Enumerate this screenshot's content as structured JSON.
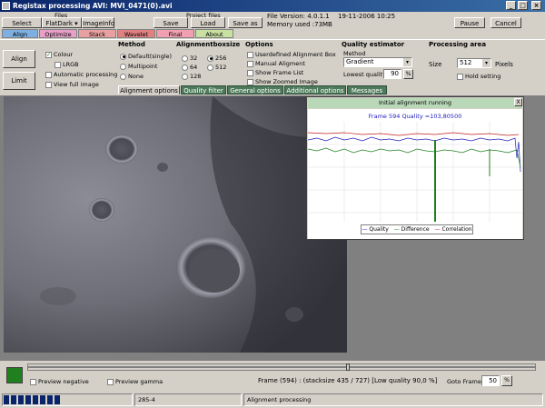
{
  "window": {
    "title": "Registax processing AVI: MVI_0471(0).avi"
  },
  "toolbar": {
    "files_label": "Files",
    "select": "Select",
    "flatdark": "FlatDark",
    "imageinfo": "ImageInfo",
    "project_files_label": "Project files",
    "save": "Save",
    "load": "Load",
    "save_as": "Save as",
    "file_version": "File Version: 4.0.1.1",
    "date": "19-11-2006 10:25",
    "memory": "Memory used :73MB",
    "pause": "Pause",
    "cancel": "Cancel"
  },
  "tabs": [
    {
      "label": "Align",
      "color": "#7db0e0"
    },
    {
      "label": "Optimize",
      "color": "#e8a0c8"
    },
    {
      "label": "Stack",
      "color": "#e8a0a0"
    },
    {
      "label": "Wavelet",
      "color": "#e08080"
    },
    {
      "label": "Final",
      "color": "#f0a0b0"
    },
    {
      "label": "About",
      "color": "#c8e0a0"
    }
  ],
  "side": {
    "align": "Align",
    "limit": "Limit"
  },
  "checks": {
    "colour": "Colour",
    "lrgb": "LRGB",
    "auto_processing": "Automatic processing",
    "view_full": "View full image"
  },
  "method": {
    "title": "Method",
    "default": "Default(single)",
    "multipoint": "Multipoint",
    "none": "None"
  },
  "boxsize": {
    "title": "Alignmentboxsize",
    "v32": "32",
    "v64": "64",
    "v128": "128",
    "v256": "256",
    "v512": "512"
  },
  "options": {
    "title": "Options",
    "userdefined": "Userdefined Alignment Box",
    "manual": "Manual Aligment",
    "show_frame_list": "Show Frame List",
    "show_zoomed": "Show Zoomed Image"
  },
  "quality": {
    "title": "Quality estimator",
    "method_label": "Method",
    "method_value": "Gradient",
    "lowest_label": "Lowest quality",
    "lowest_value": "90"
  },
  "processing": {
    "title": "Processing area",
    "size_label": "Size",
    "size_value": "512",
    "pixels": "Pixels",
    "hold": "Hold setting"
  },
  "subtabs": [
    "Alignment options",
    "Quality filter",
    "General options",
    "Additional options",
    "Messages"
  ],
  "popup": {
    "title": "Initial alignment running",
    "close": "X",
    "graph_title": "Frame 594 Quality =103,80500",
    "legend": [
      "Quality",
      "Difference",
      "Correlation"
    ]
  },
  "chart_colors": {
    "quality": "#2020c0",
    "difference": "#208020",
    "correlation": "#c02020"
  },
  "bottom": {
    "preview_negative": "Preview negative",
    "preview_gamma": "Preview gamma",
    "frame_info": "Frame (594) :   (stacksize 435 / 727) [Low quality 90,0 %]",
    "goto_label": "Goto Frame",
    "goto_value": "50"
  },
  "status": {
    "progress_value": "285-4",
    "message": "Alignment processing",
    "progress_fraction": 0.45
  }
}
